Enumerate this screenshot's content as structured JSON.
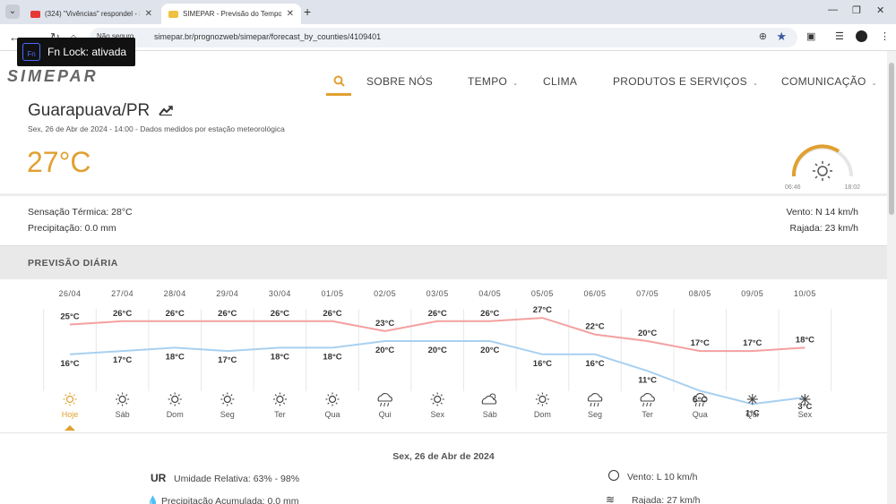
{
  "browser": {
    "tabs": [
      {
        "title": "(324) \"Vivências\" respondel - SI",
        "favicon_color": "#e53935",
        "active": false
      },
      {
        "title": "SIMEPAR - Previsão do Tempo",
        "favicon_color": "#f0c040",
        "active": true
      }
    ],
    "new_tab_symbol": "+",
    "not_secure_label": "Não seguro",
    "url": "simepar.br/prognozweb/simepar/forecast_by_counties/4109401"
  },
  "fn_lock": {
    "badge": "Fn",
    "label": "Fn Lock: ativada"
  },
  "site": {
    "logo_text": "SIMEPAR",
    "menu": [
      {
        "label": "SOBRE NÓS",
        "has_dropdown": false
      },
      {
        "label": "TEMPO",
        "has_dropdown": true
      },
      {
        "label": "CLIMA",
        "has_dropdown": false
      },
      {
        "label": "PRODUTOS E SERVIÇOS",
        "has_dropdown": true
      },
      {
        "label": "COMUNICAÇÃO",
        "has_dropdown": true
      }
    ],
    "accent_color": "#e0a030"
  },
  "current": {
    "city": "Guarapuava/PR",
    "datetime": "Sex, 26 de Abr de 2024 - 14:00 - Dados medidos por estação meteorológica",
    "temperature": "27°C",
    "sunrise": "06:46",
    "sunset": "18:02",
    "feels_like": "Sensação Térmica: 28°C",
    "precipitation": "Precipitação: 0.0 mm",
    "wind": "Vento: N 14 km/h",
    "gust": "Rajada: 23 km/h"
  },
  "daily_section_title": "PREVISÃO DIÁRIA",
  "chart_data": {
    "type": "line",
    "categories": [
      "26/04",
      "27/04",
      "28/04",
      "29/04",
      "30/04",
      "01/05",
      "02/05",
      "03/05",
      "04/05",
      "05/05",
      "06/05",
      "07/05",
      "08/05",
      "09/05",
      "10/05"
    ],
    "day_names": [
      "Hoje",
      "Sáb",
      "Dom",
      "Seg",
      "Ter",
      "Qua",
      "Qui",
      "Sex",
      "Sáb",
      "Dom",
      "Seg",
      "Ter",
      "Qua",
      "Qui",
      "Sex"
    ],
    "weather_icons": [
      "sun-icon",
      "sun-icon",
      "sun-icon",
      "sun-icon",
      "sun-icon",
      "sun-icon",
      "rain-cloud-icon",
      "sun-icon",
      "partly-cloudy-icon",
      "sun-icon",
      "rain-cloud-icon",
      "rain-cloud-icon",
      "rain-cloud-icon",
      "clear-night-icon",
      "clear-night-icon"
    ],
    "series": [
      {
        "values": [
          25,
          26,
          26,
          26,
          26,
          26,
          23,
          26,
          26,
          27,
          22,
          20,
          17,
          17,
          18
        ],
        "color": "#f4a0a0"
      },
      {
        "values": [
          16,
          17,
          18,
          17,
          18,
          18,
          20,
          20,
          20,
          16,
          16,
          11,
          5,
          1,
          3
        ],
        "color": "#a8d0f0"
      }
    ],
    "unit": "°C",
    "selected_index": 0
  },
  "detail": {
    "date": "Sex, 26 de Abr de 2024",
    "ur_label": "UR",
    "humidity": "Umidade Relativa: 63% - 98%",
    "precip": "Precipitação Acumulada: 0.0 mm",
    "wind": "Vento: L 10 km/h",
    "gust": "Rajada: 27 km/h"
  }
}
